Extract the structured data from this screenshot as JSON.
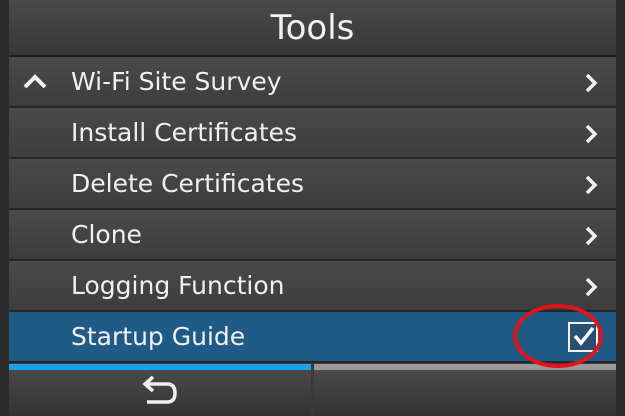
{
  "header": {
    "title": "Tools"
  },
  "menu": {
    "items": [
      {
        "label": "Wi-Fi Site Survey"
      },
      {
        "label": "Install Certificates"
      },
      {
        "label": "Delete Certificates"
      },
      {
        "label": "Clone"
      },
      {
        "label": "Logging Function"
      },
      {
        "label": "Startup Guide",
        "checked": true
      }
    ]
  },
  "icons": {
    "scroll_up": "chevron-up-icon",
    "submenu": "chevron-right-icon",
    "back": "return-arrow-icon",
    "checkbox": "checkbox-checked-icon"
  },
  "colors": {
    "selected_row": "#1f5b86",
    "active_tab_bar": "#1aa3e8",
    "inactive_tab_bar": "#9a9a9a",
    "highlight_circle": "#e0141b"
  }
}
